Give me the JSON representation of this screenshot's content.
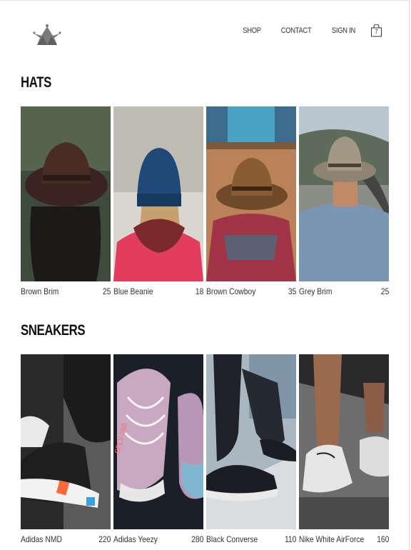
{
  "nav": {
    "shop": "SHOP",
    "contact": "CONTACT",
    "signin": "SIGN IN",
    "bag_count": "7"
  },
  "sections": [
    {
      "title": "HATS",
      "items": [
        {
          "name": "Brown Brim",
          "price": "25"
        },
        {
          "name": "Blue Beanie",
          "price": "18"
        },
        {
          "name": "Brown Cowboy",
          "price": "35"
        },
        {
          "name": "Grey Brim",
          "price": "25"
        }
      ]
    },
    {
      "title": "SNEAKERS",
      "items": [
        {
          "name": "Adidas NMD",
          "price": "220"
        },
        {
          "name": "Adidas Yeezy",
          "price": "280"
        },
        {
          "name": "Black Converse",
          "price": "110"
        },
        {
          "name": "Nike White AirForce",
          "price": "160"
        }
      ]
    }
  ],
  "icons": {
    "logo": "crown-icon",
    "bag": "shopping-bag-icon"
  }
}
